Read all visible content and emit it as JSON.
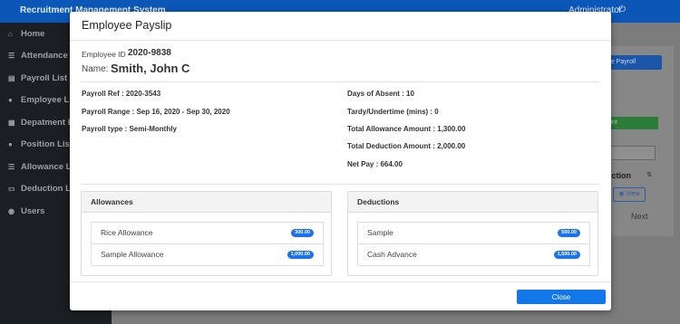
{
  "app": {
    "brand": "Recruitment Management System",
    "user": "Administrator",
    "sidebar": [
      {
        "icon": "home-icon",
        "glyph": "⌂",
        "label": "Home"
      },
      {
        "icon": "list-icon",
        "glyph": "☰",
        "label": "Attendance"
      },
      {
        "icon": "doc-icon",
        "glyph": "▤",
        "label": "Payroll List"
      },
      {
        "icon": "user-icon",
        "glyph": "●",
        "label": "Employee List"
      },
      {
        "icon": "building-icon",
        "glyph": "▦",
        "label": "Depatment List"
      },
      {
        "icon": "user-icon",
        "glyph": "●",
        "label": "Position List"
      },
      {
        "icon": "list-icon",
        "glyph": "☰",
        "label": "Allowance List"
      },
      {
        "icon": "card-icon",
        "glyph": "▭",
        "label": "Deduction List"
      },
      {
        "icon": "users-icon",
        "glyph": "◉",
        "label": "Users"
      }
    ],
    "bg": {
      "create_payroll": "ate Payroll",
      "print": "rint",
      "action_header": "Action",
      "view": "View",
      "next": "Next"
    }
  },
  "modal": {
    "title": "Employee Payslip",
    "employee_id_label": "Employee ID",
    "employee_id": "2020-9838",
    "name_label": "Name:",
    "name": "Smith, John C",
    "left_fields": [
      "Payroll Ref : 2020-3543",
      "Payroll Range : Sep 16, 2020 - Sep 30, 2020",
      "Payroll type : Semi-Monthly"
    ],
    "right_fields": [
      "Days of Absent : 10",
      "Tardy/Undertime (mins) : 0",
      "Total Allowance Amount : 1,300.00",
      "Total Deduction Amount : 2,000.00",
      "Net Pay : 664.00"
    ],
    "allowances": {
      "title": "Allowances",
      "items": [
        {
          "label": "Rice Allowance",
          "amount": "300.00"
        },
        {
          "label": "Sample Allowance",
          "amount": "1,000.00"
        }
      ]
    },
    "deductions": {
      "title": "Deductions",
      "items": [
        {
          "label": "Sample",
          "amount": "500.00"
        },
        {
          "label": "Cash Advance",
          "amount": "1,500.00"
        }
      ]
    },
    "close_label": "Close",
    "accent_color": "#1277e9"
  }
}
